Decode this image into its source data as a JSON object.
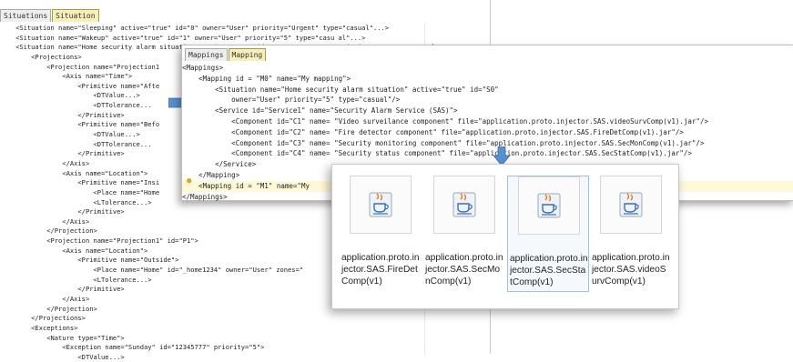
{
  "colors": {
    "selected_tab_bg": "#f6efb8",
    "arrow_blue": "#5a90d0",
    "bulb": "#e1a520"
  },
  "window1": {
    "tabs": [
      "Situations",
      "Situation"
    ],
    "lines": [
      "    <Situation name=\"Sleeping\" active=\"true\" id=\"0\" owner=\"User\" priority=\"Urgent\" type=\"casual\"...>",
      "    <Situation name=\"Wakeup\" active=\"true\" id=\"1\" owner=\"User\" priority=\"5\" type=\"casu al\"...>",
      "    <Situation name=\"Home security alarm situation\" active=\"true\" id=\"S0\" owner=\"User\" priority=\"5\" type=\"casual\">",
      "        <Projections>",
      "            <Projection name=\"Projection1",
      "                <Axis name=\"Time\">",
      "                    <Primitive name=\"Afte",
      "                        <DTValue...>",
      "                        <DTTolerance...",
      "                    </Primitive>",
      "                    <Primitive name=\"Befo",
      "                        <DTValue...>",
      "                        <DTTolerance...",
      "                    </Primitive>",
      "                </Axis>",
      "                <Axis name=\"Location\">",
      "                    <Primitive name=\"Insi",
      "                        <Place name=\"Home",
      "                        <LTolerance...>",
      "                    </Primitive>",
      "                </Axis>",
      "            </Projection>",
      "            <Projection name=\"Projection1\" id=\"P1\">",
      "                <Axis name=\"Location\">",
      "                    <Primitive name=\"Outside\">",
      "                        <Place name=\"Home\" id=\"_home1234\" owner=\"User\" zones=\"",
      "                        <LTolerance...>",
      "                    </Primitive>",
      "                </Axis>",
      "            </Projection>",
      "        </Projections>",
      "        <Exceptions>",
      "            <Nature type=\"Time\">",
      "                <Exception name=\"Sunday\" id=\"12345777\" priority=\"5\">",
      "                    <DTValue...>"
    ]
  },
  "window2": {
    "tabs": [
      "Mappings",
      "Mapping"
    ],
    "lines": [
      "<Mappings>",
      "    <Mapping id = \"M0\" name=\"My mapping\">",
      "        <Situation name=\"Home security alarm situation\" active=\"true\" id=\"S0\"",
      "            owner=\"User\" priority=\"5\" type=\"casual\"/>",
      "        <Service id=\"Service1\" name=\"Security Alarm Service (SAS)\">",
      "            <Component id=\"C1\" name= \"Video surveilance component\" file=\"application.proto.injector.SAS.videoSurvComp(v1).jar\"/>",
      "            <Component id=\"C2\" name= \"Fire detector component\" file=\"application.proto.injector.SAS.FireDetComp(v1).jar\"/>",
      "            <Component id=\"C3\" name= \"Security monitoring component\" file=\"application.proto.injector.SAS.SecMonComp(v1).jar\"/>",
      "            <Component id=\"C4\" name= \"Security status component\" file=\"application.proto.injector.SAS.SecStatComp(v1).jar\"/>",
      "        </Service>",
      "    </Mapping>",
      "    <Mapping id = \"M1\" name=\"My",
      "</Mappings>"
    ]
  },
  "files": [
    {
      "name": "application.proto.injector.SAS.FireDetComp(v1)",
      "icon": "java-icon",
      "selected": false
    },
    {
      "name": "application.proto.injector.SAS.SecMonComp(v1)",
      "icon": "java-icon",
      "selected": false
    },
    {
      "name": "application.proto.injector.SAS.SecStatComp(v1)",
      "icon": "java-icon",
      "selected": true
    },
    {
      "name": "application.proto.injector.SAS.videoSurvComp(v1)",
      "icon": "java-icon",
      "selected": false
    }
  ]
}
